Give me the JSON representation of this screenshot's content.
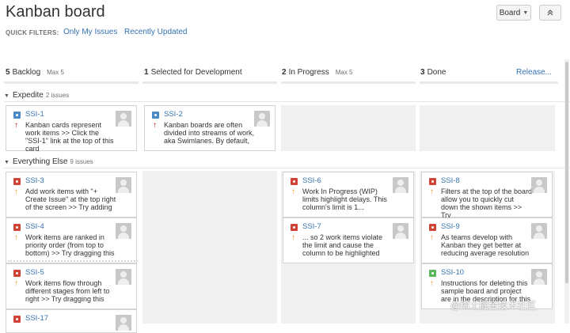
{
  "header": {
    "title": "Kanban board",
    "board_button": "Board",
    "quick_filters_label": "QUICK FILTERS:",
    "filters": [
      "Only My Issues",
      "Recently Updated"
    ]
  },
  "columns": [
    {
      "count": "5",
      "name": "Backlog",
      "max": "Max 5"
    },
    {
      "count": "1",
      "name": "Selected for Development",
      "max": ""
    },
    {
      "count": "2",
      "name": "In Progress",
      "max": "Max 5"
    },
    {
      "count": "3",
      "name": "Done",
      "max": ""
    }
  ],
  "release_link": "Release...",
  "swimlanes": [
    {
      "name": "Expedite",
      "count": "2 issues"
    },
    {
      "name": "Everything Else",
      "count": "9 issues"
    }
  ],
  "cards": {
    "ssi1": {
      "key": "SSI-1",
      "type": "task",
      "priority": "high",
      "summary": "Kanban cards represent work items >> Click the \"SSI-1\" link at the top of this card"
    },
    "ssi2": {
      "key": "SSI-2",
      "type": "task",
      "priority": "high",
      "summary": "Kanban boards are often divided into streams of work, aka Swimlanes. By default,"
    },
    "ssi3": {
      "key": "SSI-3",
      "type": "bug",
      "priority": "medium",
      "summary": "Add work items with \"+ Create Issue\" at the top right of the screen >> Try adding"
    },
    "ssi4": {
      "key": "SSI-4",
      "type": "bug",
      "priority": "medium",
      "summary": "Work items are ranked in priority order (from top to bottom) >> Try dragging this"
    },
    "ssi5": {
      "key": "SSI-5",
      "type": "bug",
      "priority": "medium",
      "summary": "Work items flow through different stages from left to right >> Try dragging this"
    },
    "ssi17": {
      "key": "SSI-17",
      "type": "bug",
      "priority": "",
      "summary": ""
    },
    "ssi6": {
      "key": "SSI-6",
      "type": "bug",
      "priority": "medium",
      "summary": "Work In Progress (WIP) limits highlight delays. This column's limit is 1..."
    },
    "ssi7": {
      "key": "SSI-7",
      "type": "bug",
      "priority": "medium",
      "summary": "... so 2 work items violate the limit and cause the column to be highlighted"
    },
    "ssi8": {
      "key": "SSI-8",
      "type": "bug",
      "priority": "medium",
      "summary": "Filters at the top of the board allow you to quickly cut down the shown items >> Try"
    },
    "ssi9": {
      "key": "SSI-9",
      "type": "bug",
      "priority": "medium",
      "summary": "As teams develop with Kanban they get better at reducing average resolution"
    },
    "ssi10": {
      "key": "SSI-10",
      "type": "story",
      "priority": "medium",
      "summary": "Instructions for deleting this sample board and project are in the description for this"
    }
  },
  "watermark": "@稀土掘金技术社区"
}
